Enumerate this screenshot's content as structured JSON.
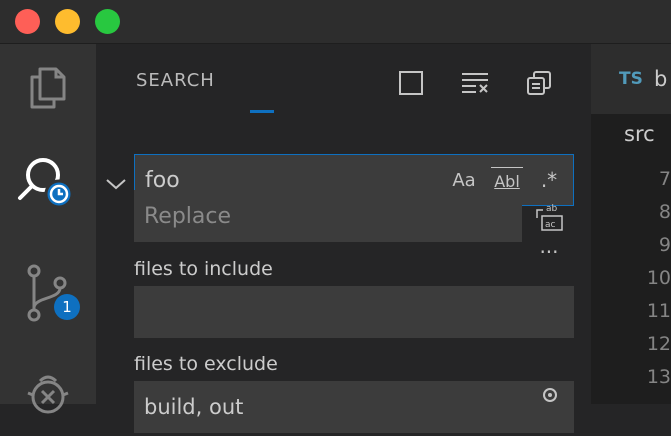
{
  "window": {
    "traffic_lights": [
      "close",
      "minimize",
      "maximize"
    ]
  },
  "activity_bar": {
    "items": [
      {
        "name": "explorer",
        "icon": "files-icon"
      },
      {
        "name": "search",
        "icon": "search-history-icon"
      },
      {
        "name": "source-control",
        "icon": "source-control-icon",
        "badge": "1"
      },
      {
        "name": "debug",
        "icon": "debug-icon"
      }
    ],
    "accent": "#0e70c0"
  },
  "sidebar": {
    "title": "SEARCH",
    "search": {
      "value": "foo",
      "options": {
        "match_case": "Aa",
        "whole_word": "Abl",
        "regex": ".*"
      }
    },
    "replace": {
      "placeholder": "Replace"
    },
    "include": {
      "label": "files to include",
      "value": ""
    },
    "exclude": {
      "label": "files to exclude",
      "value": "build, out"
    },
    "more_label": "···"
  },
  "editor": {
    "tab": {
      "lang_badge": "TS",
      "name": "b"
    },
    "breadcrumb": "src",
    "line_numbers": [
      "7",
      "8",
      "9",
      "10",
      "11",
      "12",
      "13"
    ]
  }
}
